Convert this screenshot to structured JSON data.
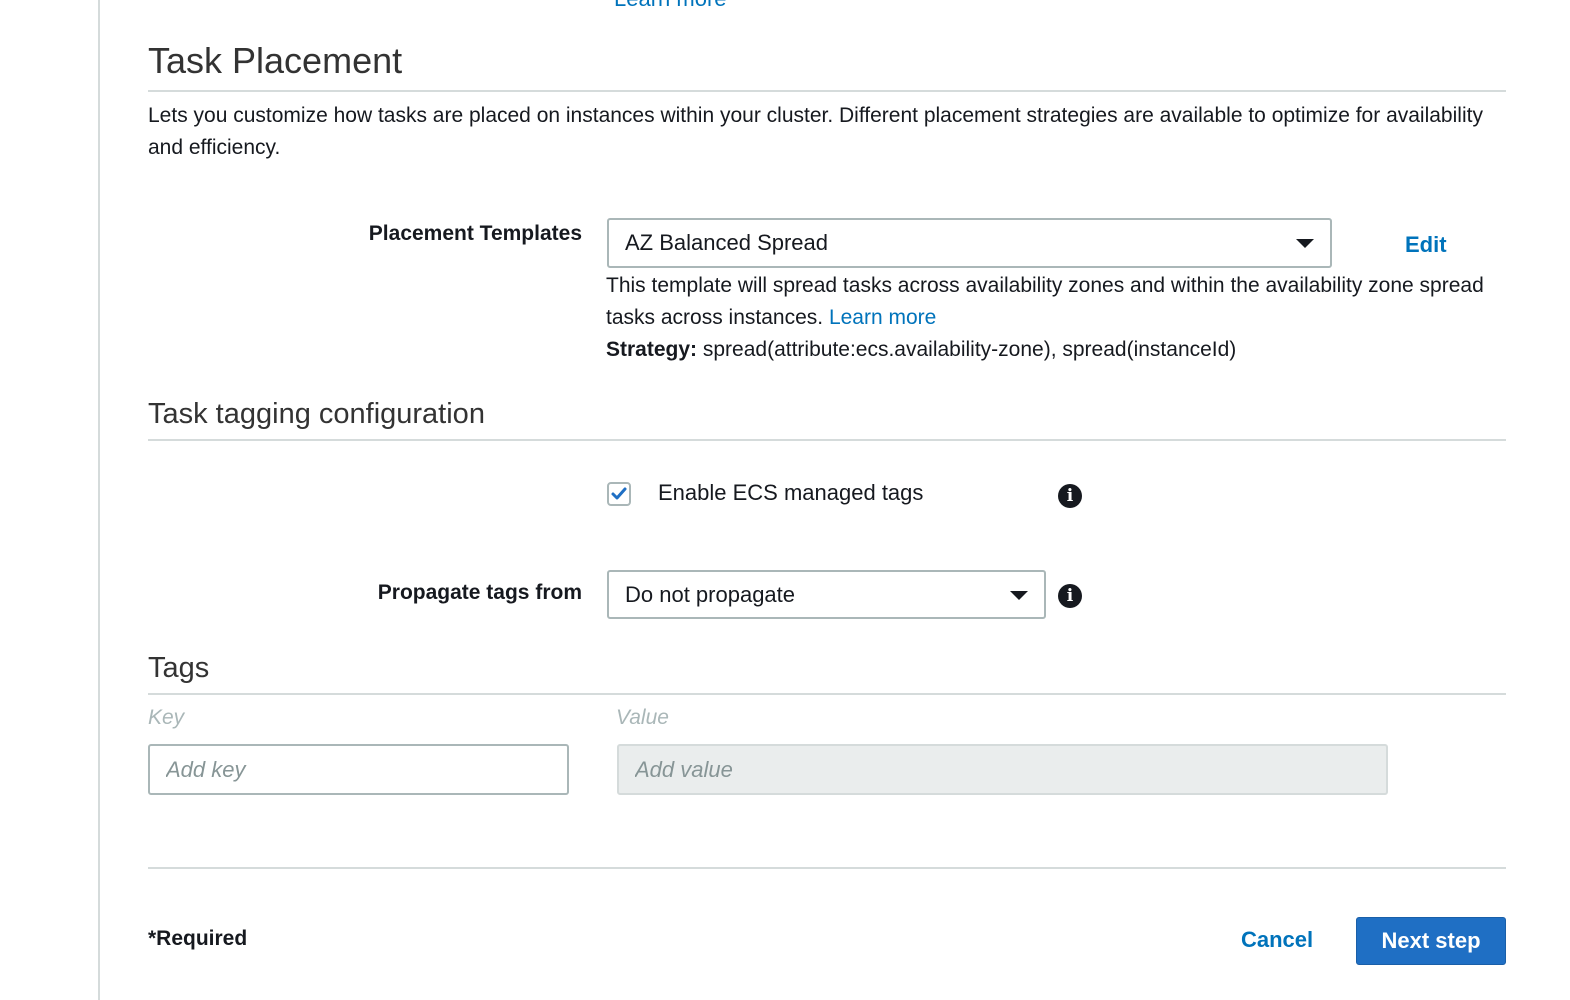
{
  "top_link": "Learn more",
  "task_placement": {
    "title": "Task Placement",
    "description": "Lets you customize how tasks are placed on instances within your cluster. Different placement strategies are available to optimize for availability and efficiency.",
    "placement_templates_label": "Placement Templates",
    "placement_templates_value": "AZ Balanced Spread",
    "edit_label": "Edit",
    "help_text": "This template will spread tasks across availability zones and within the availability zone spread tasks across instances.",
    "learn_more": "Learn more",
    "strategy_label": "Strategy:",
    "strategy_value": "spread(attribute:ecs.availability-zone), spread(instanceId)"
  },
  "task_tagging": {
    "title": "Task tagging configuration",
    "enable_ecs_tags_label": "Enable ECS managed tags",
    "enable_ecs_tags_checked": true,
    "propagate_label": "Propagate tags from",
    "propagate_value": "Do not propagate"
  },
  "tags": {
    "title": "Tags",
    "key_header": "Key",
    "value_header": "Value",
    "key_placeholder": "Add key",
    "value_placeholder": "Add value"
  },
  "footer": {
    "required_label": "*Required",
    "cancel_label": "Cancel",
    "next_label": "Next step"
  },
  "colors": {
    "link": "#0073bb",
    "primary_button": "#1f6fc4",
    "border": "#aab7b8"
  },
  "icons": {
    "info": "info-icon",
    "caret": "caret-down-icon",
    "check": "checkmark-icon"
  }
}
